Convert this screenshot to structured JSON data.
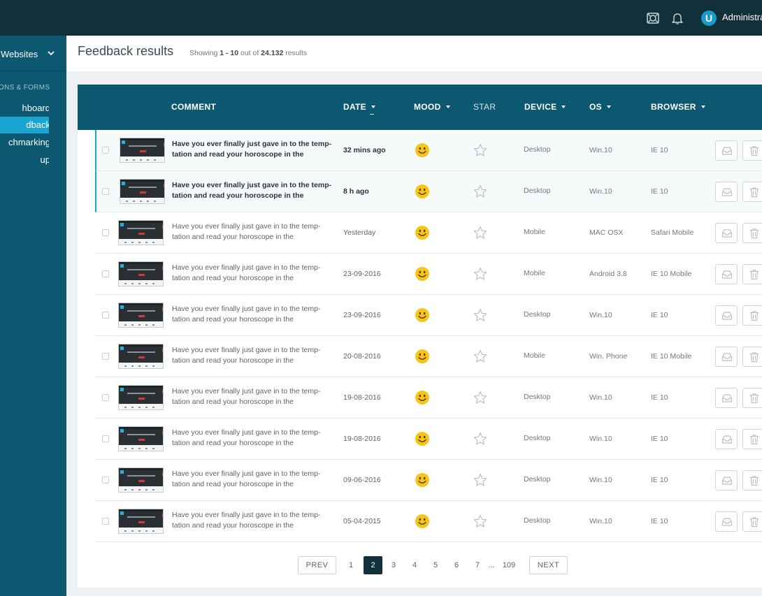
{
  "topbar": {
    "icons": [
      "support-icon",
      "bell-icon"
    ],
    "logo_letter": "U",
    "user_label": "Administra"
  },
  "sidebar": {
    "websites_label": "Websites",
    "section_label": "ONS & FORMS",
    "items": [
      {
        "label": "hboard",
        "active": false
      },
      {
        "label": "dback",
        "active": true
      },
      {
        "label": "chmarking",
        "active": false
      },
      {
        "label": "up",
        "active": false
      }
    ]
  },
  "header": {
    "title": "Feedback results",
    "showing_prefix": "Showing ",
    "range": "1 - 10",
    "out_of": " out of ",
    "total": "24.132",
    "suffix": " results"
  },
  "table": {
    "columns": {
      "comment": "COMMENT",
      "date": "DATE",
      "mood": "MOOD",
      "star": "STAR",
      "device": "DEVICE",
      "os": "OS",
      "browser": "BROWSER"
    },
    "rows": [
      {
        "unread": true,
        "comment_l1": "Have you ever finally just gave in to the temp-",
        "comment_l2": "tation and read your horoscope in the",
        "date": "32 mins ago",
        "device": "Desktop",
        "os": "Win.10",
        "browser": "IE 10"
      },
      {
        "unread": true,
        "comment_l1": "Have you ever finally just gave in to the temp-",
        "comment_l2": "tation and read your horoscope in the",
        "date": "8 h ago",
        "device": "Desktop",
        "os": "Win.10",
        "browser": "IE 10"
      },
      {
        "unread": false,
        "comment_l1": "Have you ever finally just gave in to the temp-",
        "comment_l2": "tation and read your horoscope in the",
        "date": "Yesterday",
        "device": "Mobile",
        "os": "MAC OSX",
        "browser": "Safari Mobile"
      },
      {
        "unread": false,
        "comment_l1": "Have you ever finally just gave in to the temp-",
        "comment_l2": "tation and read your horoscope in the",
        "date": "23-09-2016",
        "device": "Mobile",
        "os": "Android 3.8",
        "browser": "IE 10 Mobile"
      },
      {
        "unread": false,
        "comment_l1": "Have you ever finally just gave in to the temp-",
        "comment_l2": "tation and read your horoscope in the",
        "date": "23-09-2016",
        "device": "Desktop",
        "os": "Win.10",
        "browser": "IE 10"
      },
      {
        "unread": false,
        "comment_l1": "Have you ever finally just gave in to the temp-",
        "comment_l2": "tation and read your horoscope in the",
        "date": "20-08-2016",
        "device": "Mobile",
        "os": "Win. Phone",
        "browser": "IE 10 Mobile"
      },
      {
        "unread": false,
        "comment_l1": "Have you ever finally just gave in to the temp-",
        "comment_l2": "tation and read your horoscope in the",
        "date": "19-08-2016",
        "device": "Desktop",
        "os": "Win.10",
        "browser": "IE 10"
      },
      {
        "unread": false,
        "comment_l1": "Have you ever finally just gave in to the temp-",
        "comment_l2": "tation and read your horoscope in the",
        "date": "19-08-2016",
        "device": "Desktop",
        "os": "Win.10",
        "browser": "IE 10"
      },
      {
        "unread": false,
        "comment_l1": "Have you ever finally just gave in to the temp-",
        "comment_l2": "tation and read your horoscope in the",
        "date": "09-06-2016",
        "device": "Desktop",
        "os": "Win.10",
        "browser": "IE 10"
      },
      {
        "unread": false,
        "comment_l1": "Have you ever finally just gave in to the temp-",
        "comment_l2": "tation and read your horoscope in the",
        "date": "05-04-2015",
        "device": "Desktop",
        "os": "Win.10",
        "browser": "IE 10"
      }
    ]
  },
  "pagination": {
    "prev": "PREV",
    "next": "NEXT",
    "pages": [
      "1",
      "2",
      "3",
      "4",
      "5",
      "6",
      "7"
    ],
    "current": "2",
    "ellipsis": "...",
    "last": "109"
  },
  "colors": {
    "topbar": "#123039",
    "sidebar": "#0c5870",
    "accent": "#1aa4d2",
    "mood_face": "#f5c518"
  }
}
